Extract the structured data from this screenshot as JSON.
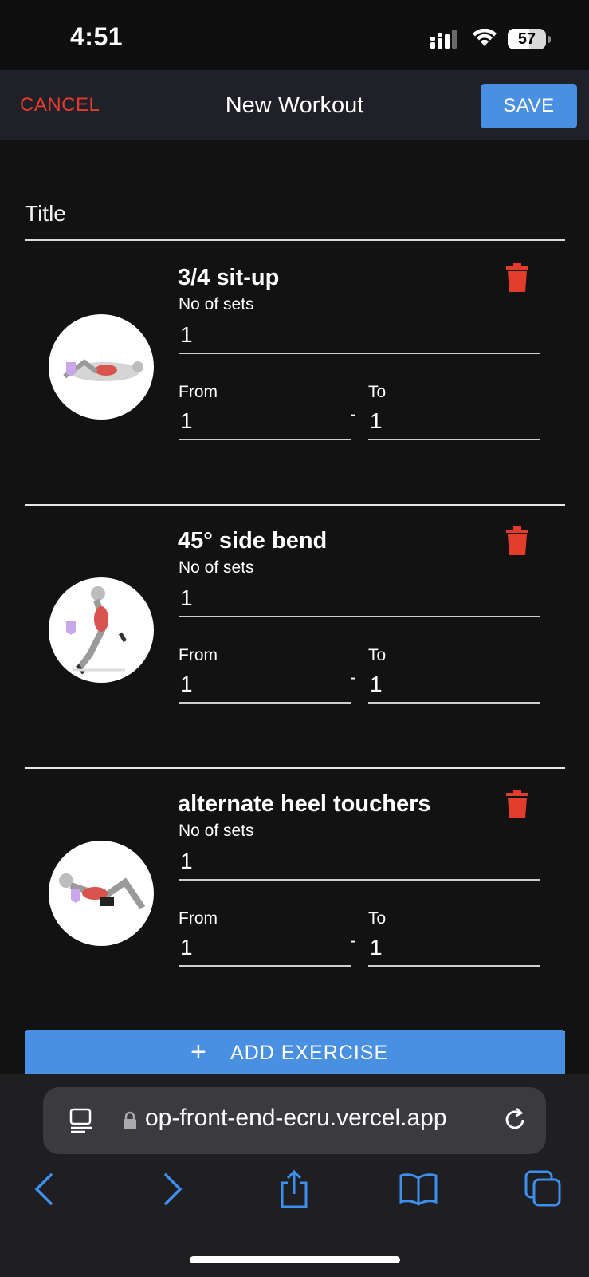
{
  "status": {
    "time": "4:51",
    "battery": "57",
    "battery_level": 0.57
  },
  "header": {
    "cancel": "CANCEL",
    "title": "New Workout",
    "save": "SAVE"
  },
  "form": {
    "title_placeholder": "Title"
  },
  "labels": {
    "sets": "No of sets",
    "from": "From",
    "to": "To",
    "dash": "-"
  },
  "exercises": [
    {
      "name": "3/4 sit-up",
      "sets": "1",
      "from": "1",
      "to": "1"
    },
    {
      "name": "45° side bend",
      "sets": "1",
      "from": "1",
      "to": "1"
    },
    {
      "name": "alternate heel touchers",
      "sets": "1",
      "from": "1",
      "to": "1"
    }
  ],
  "add_button": {
    "label": "ADD EXERCISE"
  },
  "browser": {
    "url": "op-front-end-ecru.vercel.app"
  },
  "colors": {
    "accent": "#4a90e2",
    "danger": "#e23c2c",
    "background": "#121212",
    "header": "#202028"
  },
  "icons": {
    "status": [
      "signal-icon",
      "wifi-icon",
      "battery-icon"
    ],
    "exercise": [
      "trash-icon"
    ],
    "browser": [
      "reader-icon",
      "lock-icon",
      "reload-icon",
      "back-icon",
      "forward-icon",
      "share-icon",
      "bookmarks-icon",
      "tabs-icon"
    ]
  }
}
